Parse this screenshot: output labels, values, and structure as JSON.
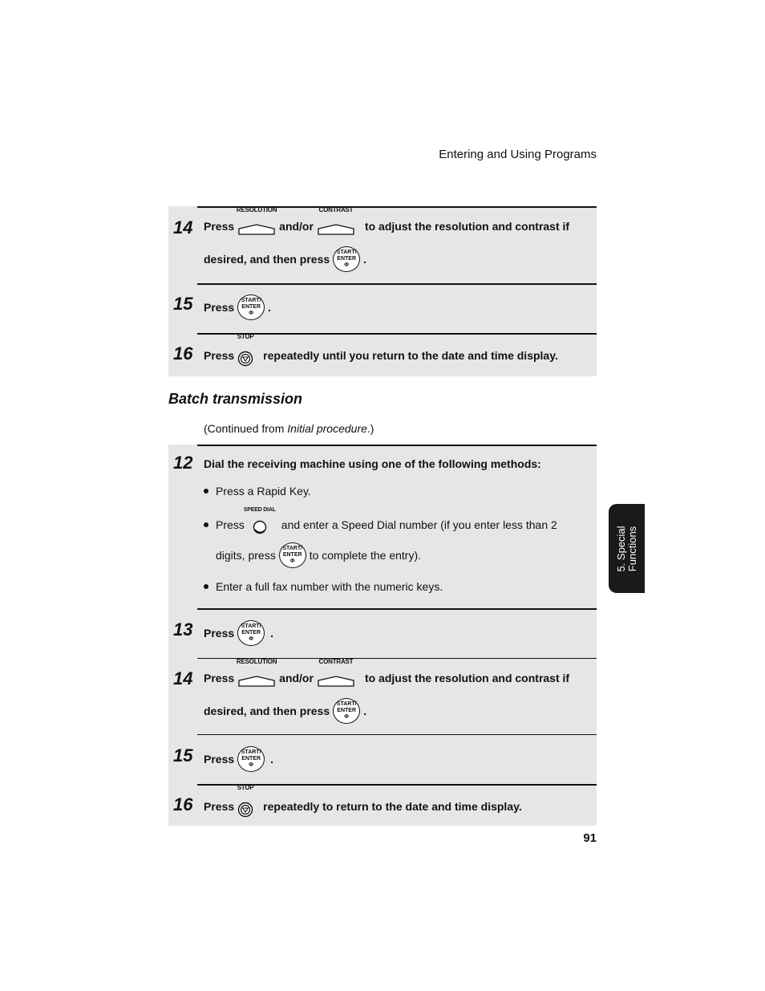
{
  "header": {
    "running_title": "Entering and Using Programs"
  },
  "keys": {
    "resolution": "RESOLUTION",
    "contrast": "CONTRAST",
    "start_line1": "START/",
    "start_line2": "ENTER",
    "stop": "STOP",
    "speed_dial": "SPEED DIAL"
  },
  "top_block": {
    "steps": [
      {
        "number": "14",
        "press": "Press",
        "andor": "and/or",
        "text_after": "to adjust the resolution and contrast if",
        "line2": "desired, and then press",
        "period": "."
      },
      {
        "number": "15",
        "press": "Press",
        "period": "."
      },
      {
        "number": "16",
        "press": "Press",
        "text_after": "repeatedly until you return to the date and time display."
      }
    ]
  },
  "section": {
    "title": "Batch transmission",
    "continued_prefix": "(Continued from ",
    "continued_italic": "Initial procedure",
    "continued_suffix": ".)"
  },
  "batch_block": {
    "steps": [
      {
        "number": "12",
        "text": "Dial the receiving machine using one of the following methods:",
        "bullets": [
          {
            "text": "Press a Rapid Key."
          },
          {
            "press": "Press",
            "text_after": "and enter a Speed Dial number (if you enter less than 2",
            "line2_before": "digits, press",
            "line2_after": "to complete the entry)."
          },
          {
            "text": "Enter a full fax number with the numeric keys."
          }
        ]
      },
      {
        "number": "13",
        "press": "Press",
        "period": "."
      },
      {
        "number": "14",
        "press": "Press",
        "andor": "and/or",
        "text_after": "to adjust the resolution and contrast if",
        "line2": "desired, and then press",
        "period": "."
      },
      {
        "number": "15",
        "press": "Press",
        "period": "."
      },
      {
        "number": "16",
        "press": "Press",
        "text_after": "repeatedly to return to the date and time display."
      }
    ]
  },
  "side_tab": {
    "line1": "5. Special",
    "line2": "Functions"
  },
  "footer": {
    "page_number": "91"
  }
}
